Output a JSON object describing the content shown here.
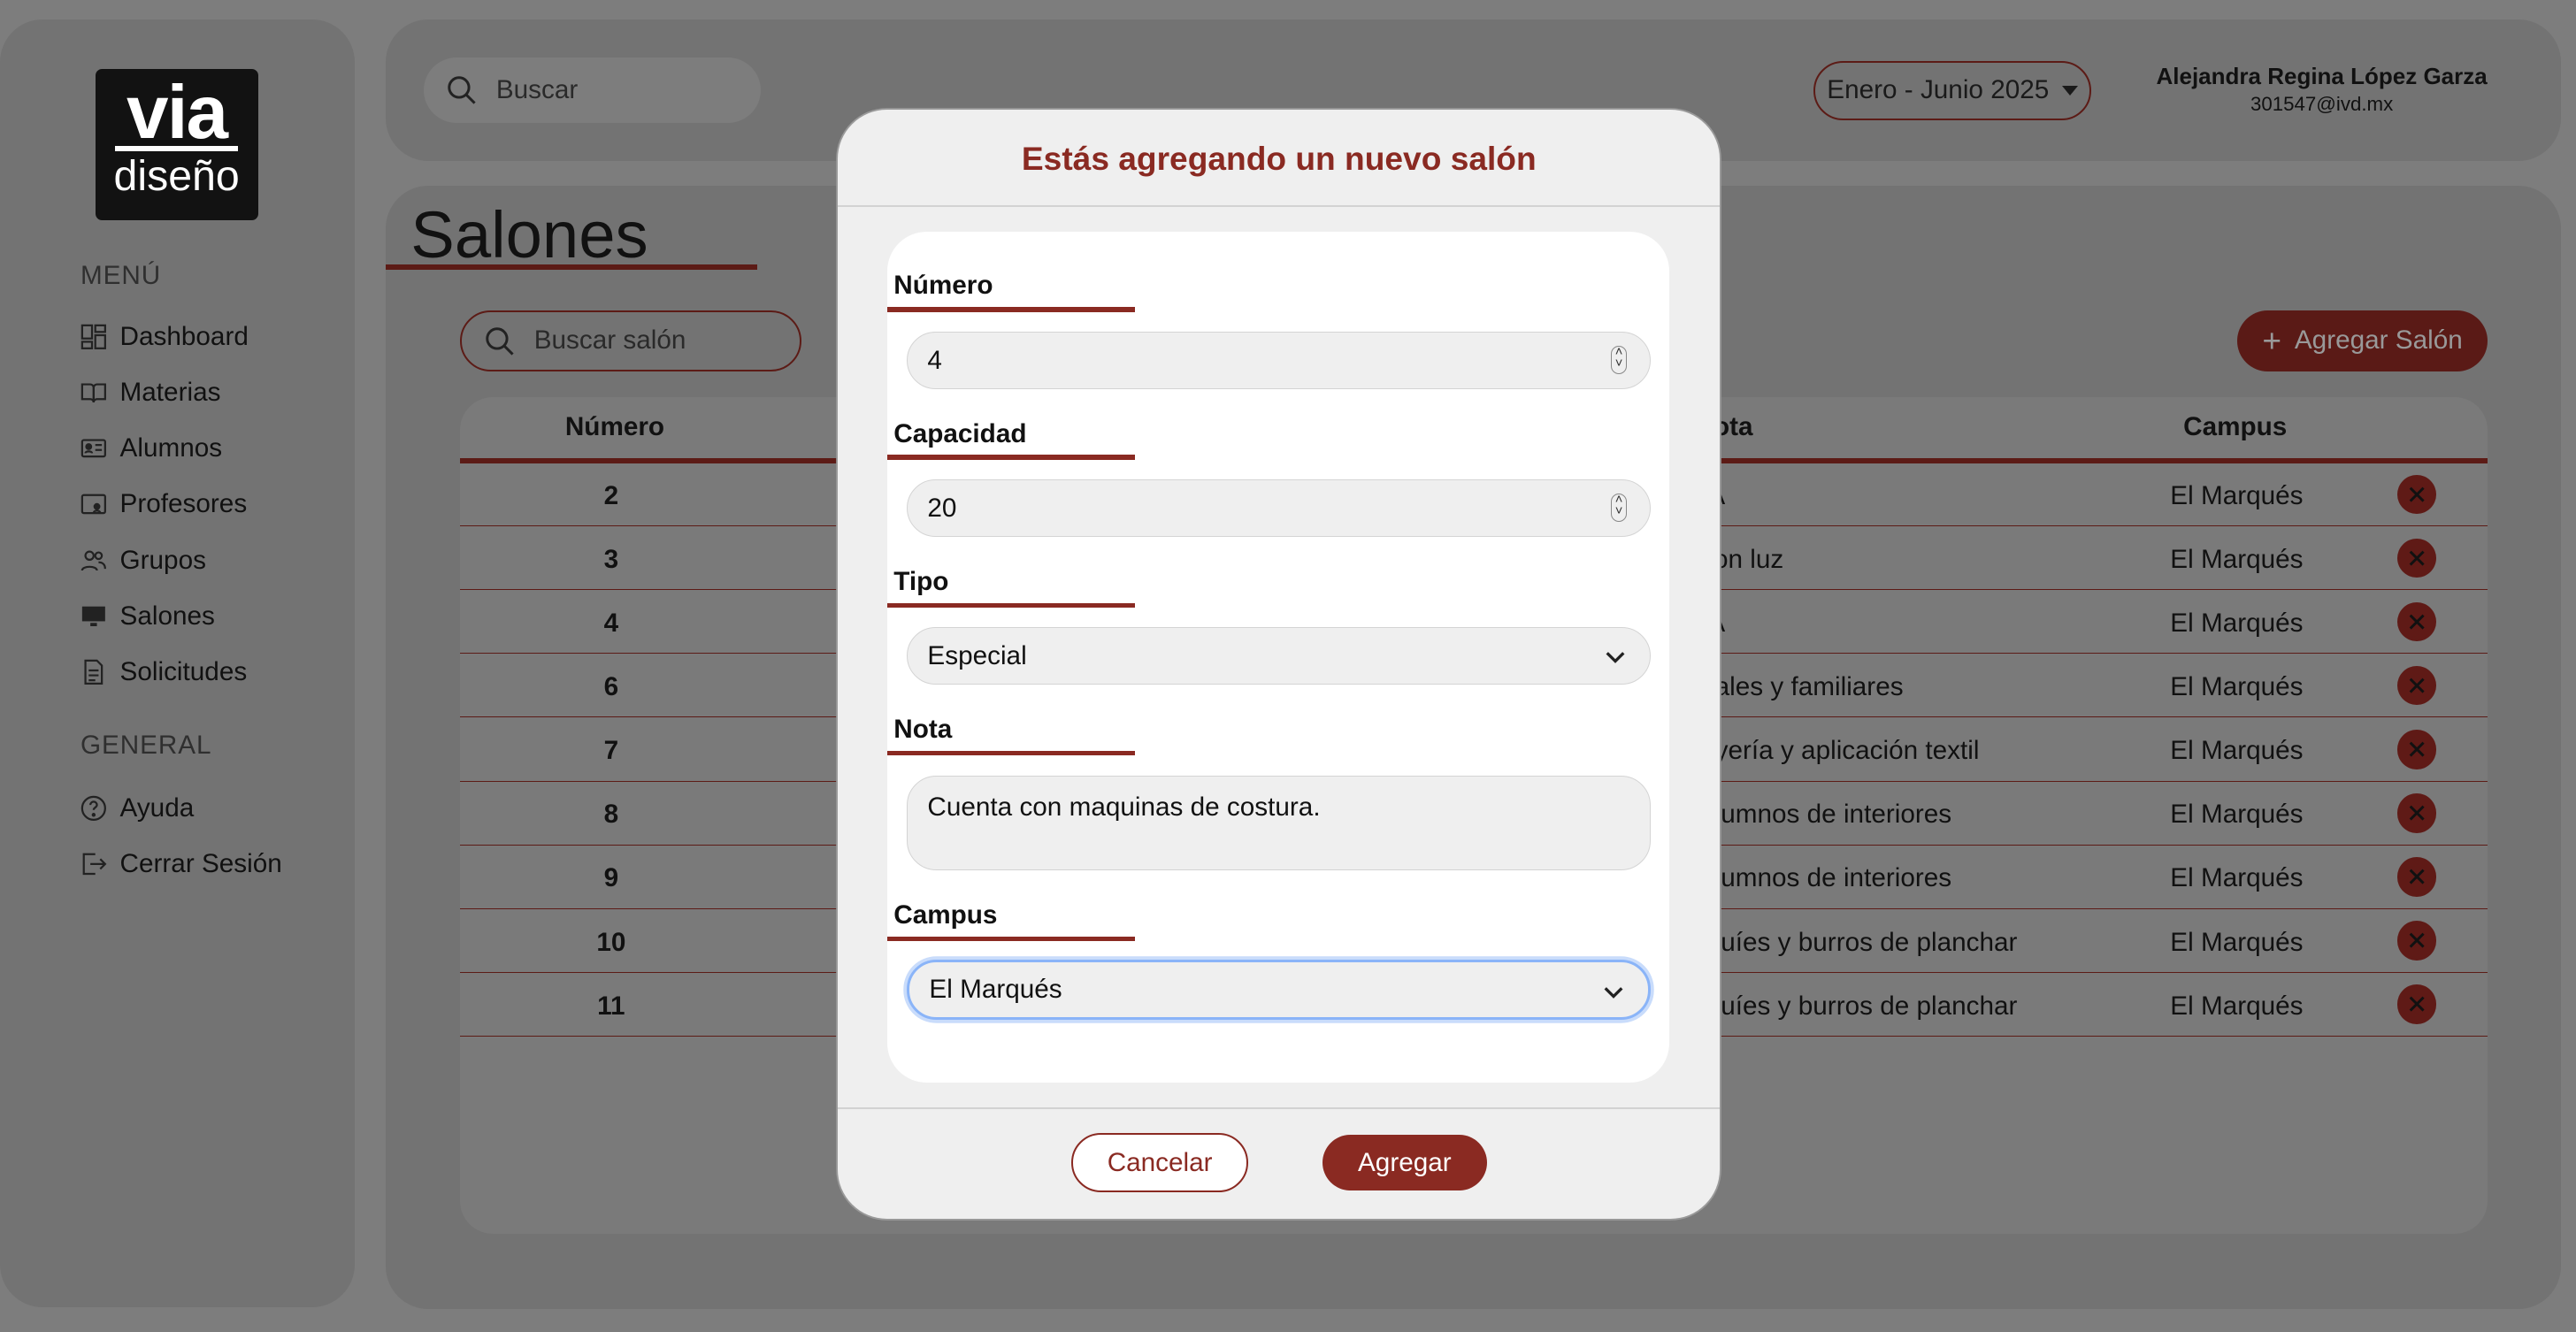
{
  "logo": {
    "line1": "via",
    "line2": "diseño"
  },
  "sidebar": {
    "menu_label": "MENÚ",
    "items": [
      {
        "label": "Dashboard",
        "icon": "dashboard-icon"
      },
      {
        "label": "Materias",
        "icon": "book-icon"
      },
      {
        "label": "Alumnos",
        "icon": "id-card-icon"
      },
      {
        "label": "Profesores",
        "icon": "teacher-icon"
      },
      {
        "label": "Grupos",
        "icon": "users-icon"
      },
      {
        "label": "Salones",
        "icon": "classroom-icon"
      },
      {
        "label": "Solicitudes",
        "icon": "document-icon"
      }
    ],
    "general_label": "GENERAL",
    "general_items": [
      {
        "label": "Ayuda",
        "icon": "help-icon"
      },
      {
        "label": "Cerrar Sesión",
        "icon": "logout-icon"
      }
    ]
  },
  "header": {
    "search_placeholder": "Buscar",
    "period": "Enero - Junio 2025",
    "user_name": "Alejandra Regina López Garza",
    "user_email": "301547@ivd.mx"
  },
  "main": {
    "title": "Salones",
    "search_placeholder": "Buscar salón",
    "add_button": "Agregar Salón",
    "columns": {
      "numero": "Número",
      "nota": "ota",
      "campus": "Campus"
    },
    "rows": [
      {
        "numero": "2",
        "nota": "/A",
        "campus": "El Marqués"
      },
      {
        "numero": "3",
        "nota": "con luz",
        "campus": "El Marqués"
      },
      {
        "numero": "4",
        "nota": "/A",
        "campus": "El Marqués"
      },
      {
        "numero": "6",
        "nota": "riales y familiares",
        "campus": "El Marqués"
      },
      {
        "numero": "7",
        "nota": "oyería y aplicación textil",
        "campus": "El Marqués"
      },
      {
        "numero": "8",
        "nota": "alumnos de interiores",
        "campus": "El Marqués"
      },
      {
        "numero": "9",
        "nota": "alumnos de interiores",
        "campus": "El Marqués"
      },
      {
        "numero": "10",
        "nota": "iquíes y burros de planchar",
        "campus": "El Marqués"
      },
      {
        "numero": "11",
        "nota": "iquíes y burros de planchar",
        "campus": "El Marqués"
      }
    ]
  },
  "modal": {
    "title": "Estás agregando un nuevo salón",
    "fields": {
      "numero": {
        "label": "Número",
        "value": "4"
      },
      "capacidad": {
        "label": "Capacidad",
        "value": "20"
      },
      "tipo": {
        "label": "Tipo",
        "value": "Especial"
      },
      "nota": {
        "label": "Nota",
        "value": "Cuenta con maquinas de costura."
      },
      "campus": {
        "label": "Campus",
        "value": "El Marqués"
      }
    },
    "cancel_label": "Cancelar",
    "add_label": "Agregar"
  },
  "colors": {
    "accent": "#8a2a22",
    "overlay": "#7d7d7d"
  }
}
